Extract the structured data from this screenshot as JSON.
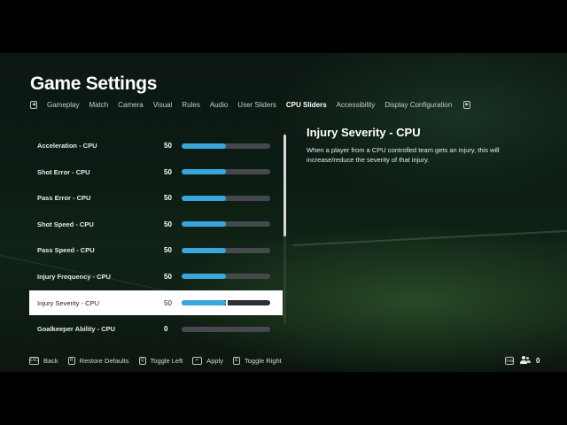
{
  "header": {
    "title": "Game Settings",
    "left_key": "◀",
    "right_key": "▶"
  },
  "tabs": [
    {
      "label": "Gameplay",
      "active": false
    },
    {
      "label": "Match",
      "active": false
    },
    {
      "label": "Camera",
      "active": false
    },
    {
      "label": "Visual",
      "active": false
    },
    {
      "label": "Rules",
      "active": false
    },
    {
      "label": "Audio",
      "active": false
    },
    {
      "label": "User Sliders",
      "active": false
    },
    {
      "label": "CPU Sliders",
      "active": true
    },
    {
      "label": "Accessibility",
      "active": false
    },
    {
      "label": "Display Configuration",
      "active": false
    }
  ],
  "sliders": [
    {
      "label": "Acceleration - CPU",
      "value": "50",
      "level": 0.5
    },
    {
      "label": "Shot Error - CPU",
      "value": "50",
      "level": 0.5
    },
    {
      "label": "Pass Error - CPU",
      "value": "50",
      "level": 0.5
    },
    {
      "label": "Shot Speed - CPU",
      "value": "50",
      "level": 0.5
    },
    {
      "label": "Pass Speed - CPU",
      "value": "50",
      "level": 0.5
    },
    {
      "label": "Injury Frequency - CPU",
      "value": "50",
      "level": 0.5
    },
    {
      "label": "Injury Severity - CPU",
      "value": "50",
      "level": 0.5,
      "selected": true
    },
    {
      "label": "Goalkeeper Ability - CPU",
      "value": "0",
      "level": 0.0
    }
  ],
  "detail": {
    "title": "Injury Severity - CPU",
    "description": "When a player from a CPU controlled team gets an injury, this will increase/reduce the severity of that injury."
  },
  "footer": {
    "buttons": [
      {
        "key": "ESC",
        "label": "Back"
      },
      {
        "key": "R",
        "label": "Restore Defaults"
      },
      {
        "key": "Q",
        "label": "Toggle Left"
      },
      {
        "key": "↵",
        "label": "Apply"
      },
      {
        "key": "E",
        "label": "Toggle Right"
      }
    ],
    "tab_key": "TAB",
    "player_count": "0"
  },
  "colors": {
    "accent_fill": "#3aa7dc",
    "track": "#45494d",
    "selected_row_bg": "#ffffff"
  }
}
